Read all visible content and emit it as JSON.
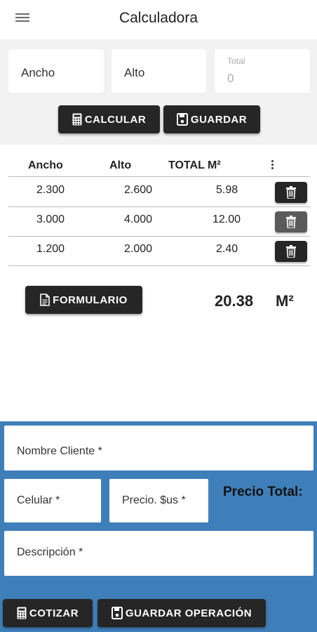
{
  "appbar": {
    "title": "Calculadora",
    "menu_icon": "menu-icon"
  },
  "inputs": {
    "ancho_label": "Ancho",
    "alto_label": "Alto",
    "total_label": "Total",
    "total_value": "0"
  },
  "buttons": {
    "calcular": "CALCULAR",
    "guardar": "GUARDAR",
    "formulario": "FORMULARIO",
    "cotizar": "COTIZAR",
    "guardar_operacion": "GUARDAR OPERACIÓN"
  },
  "table": {
    "headers": [
      "Ancho",
      "Alto",
      "TOTAL M²"
    ],
    "rows": [
      {
        "ancho": "2.300",
        "alto": "2.600",
        "total": "5.98"
      },
      {
        "ancho": "3.000",
        "alto": "4.000",
        "total": "12.00"
      },
      {
        "ancho": "1.200",
        "alto": "2.000",
        "total": "2.40"
      }
    ]
  },
  "summary": {
    "total": "20.38",
    "unit": "M²"
  },
  "form": {
    "nombre_cliente": "Nombre Cliente *",
    "celular": "Celular *",
    "precio": "Precio. $us *",
    "precio_total": "Precio Total:",
    "descripcion": "Descripción *"
  },
  "colors": {
    "button": "#262626",
    "form_background": "#3f7fb9",
    "input_area": "#f2f2f2"
  }
}
